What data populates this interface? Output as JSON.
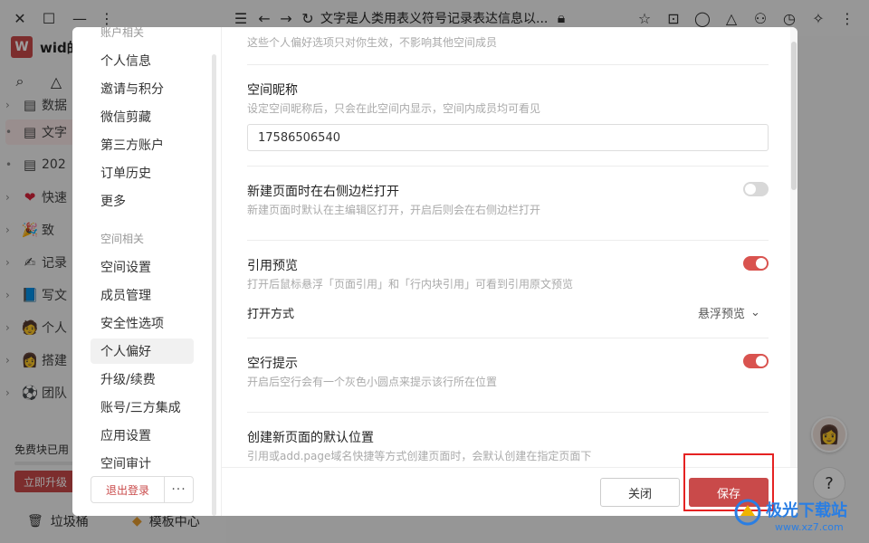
{
  "titlebar": {
    "title": "文字是人类用表义符号记录表达信息以..."
  },
  "workspace": {
    "logo_letter": "W",
    "name": "wid的"
  },
  "sidebar": {
    "items": [
      {
        "chev": "›",
        "icon": "▤",
        "label": "数据"
      },
      {
        "chev": "•",
        "icon": "▤",
        "label": "文字"
      },
      {
        "chev": "•",
        "icon": "▤",
        "label": "202"
      },
      {
        "chev": "›",
        "icon": "❤",
        "label": "快速"
      },
      {
        "chev": "›",
        "icon": "🎉",
        "label": "致"
      },
      {
        "chev": "›",
        "icon": "✍",
        "label": "记录"
      },
      {
        "chev": "›",
        "icon": "📘",
        "label": "写文"
      },
      {
        "chev": "›",
        "icon": "🧑",
        "label": "个人"
      },
      {
        "chev": "›",
        "icon": "👩",
        "label": "搭建"
      },
      {
        "chev": "›",
        "icon": "⚽",
        "label": "团队"
      }
    ],
    "free_label": "免费块已用",
    "upgrade_label": "立即升级",
    "trash_label": "垃圾桶",
    "template_label": "模板中心"
  },
  "modal": {
    "nav": {
      "group_account": "账户相关",
      "account_items": [
        "个人信息",
        "邀请与积分",
        "微信剪藏",
        "第三方账户",
        "订单历史",
        "更多"
      ],
      "group_space": "空间相关",
      "space_items": [
        "空间设置",
        "成员管理",
        "安全性选项",
        "个人偏好",
        "升级/续费",
        "账号/三方集成",
        "应用设置",
        "空间审计"
      ],
      "logout_label": "退出登录",
      "more_label": "···"
    },
    "content": {
      "top_desc": "这些个人偏好选项只对你生效，不影响其他空间成员",
      "nickname": {
        "title": "空间昵称",
        "desc": "设定空间昵称后，只会在此空间内显示，空间内成员均可看见",
        "value": "17586506540"
      },
      "open_right": {
        "title": "新建页面时在右侧边栏打开",
        "desc": "新建页面时默认在主编辑区打开，开启后则会在右侧边栏打开",
        "enabled": false
      },
      "quote_preview": {
        "title": "引用预览",
        "desc": "打开后鼠标悬浮「页面引用」和「行内块引用」可看到引用原文预览",
        "enabled": true,
        "open_mode_label": "打开方式",
        "open_mode_value": "悬浮预览"
      },
      "empty_line": {
        "title": "空行提示",
        "desc": "开启后空行会有一个灰色小圆点来提示该行所在位置",
        "enabled": true
      },
      "default_location": {
        "title": "创建新页面的默认位置",
        "desc": "引用或add.page域名快捷等方式创建页面时，会默认创建在指定页面下"
      }
    },
    "footer": {
      "close_label": "关闭",
      "save_label": "保存"
    }
  },
  "watermark": {
    "text": "极光下载站",
    "url": "www.xz7.com"
  },
  "colors": {
    "accent": "#c94a4a",
    "toggle_on": "#d9534f",
    "highlight": "#e52222"
  }
}
